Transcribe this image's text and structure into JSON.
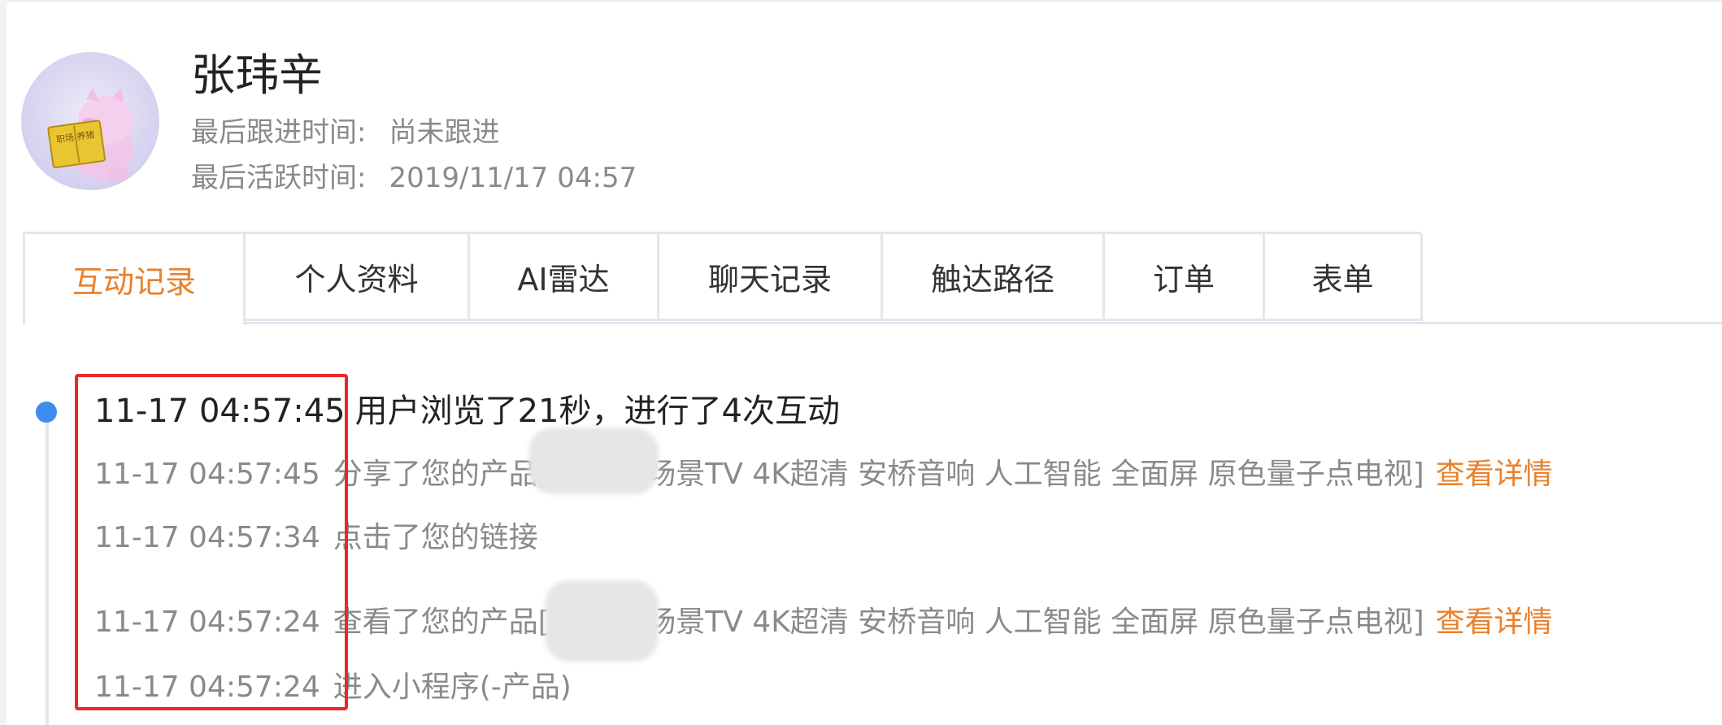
{
  "profile": {
    "name": "张玮辛",
    "last_followup_label": "最后跟进时间:",
    "last_followup_value": "尚未跟进",
    "last_active_label": "最后活跃时间:",
    "last_active_value": "2019/11/17 04:57",
    "avatar_book_text": "职场 养猪"
  },
  "tabs": [
    {
      "label": "互动记录",
      "active": true
    },
    {
      "label": "个人资料",
      "active": false
    },
    {
      "label": "AI雷达",
      "active": false
    },
    {
      "label": "聊天记录",
      "active": false
    },
    {
      "label": "触达路径",
      "active": false
    },
    {
      "label": "订单",
      "active": false
    },
    {
      "label": "表单",
      "active": false
    }
  ],
  "timeline": {
    "summary": {
      "time": "11-17 04:57:45",
      "text": "用户浏览了21秒，进行了4次互动"
    },
    "events": [
      {
        "time": "11-17 04:57:45",
        "text": "分享了您的产品[                 浮窗全场景TV 4K超清 安桥音响 人工智能 全面屏 原色量子点电视]",
        "link": "查看详情"
      },
      {
        "time": "11-17 04:57:34",
        "text": "点击了您的链接",
        "link": ""
      },
      {
        "time": "11-17 04:57:24",
        "text": "查看了您的产品[                 浮窗全场景TV 4K超清 安桥音响 人工智能 全面屏 原色量子点电视]",
        "link": "查看详情"
      },
      {
        "time": "11-17 04:57:24",
        "text": "进入小程序(-产品)",
        "link": ""
      }
    ]
  },
  "colors": {
    "accent": "#e8812c",
    "timeline_dot": "#3e8cf0",
    "highlight": "#e8282a",
    "muted_text": "#8a8a8a"
  }
}
